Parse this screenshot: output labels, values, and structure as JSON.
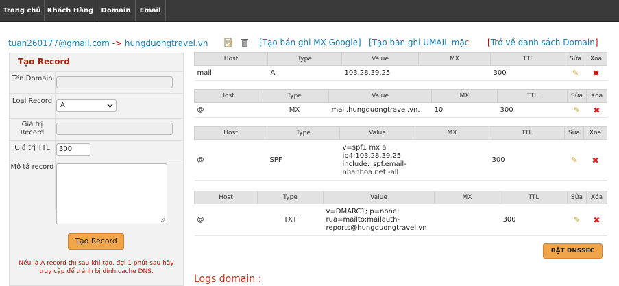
{
  "nav": [
    "Trang chủ",
    "Khách Hàng",
    "Domain",
    "Email"
  ],
  "header": {
    "email": "tuan260177@gmail.com",
    "arrow": "->",
    "domain": "hungduongtravel.vn",
    "link_mx": "[Tạo bản ghi MX Google]",
    "link_umail": "[Tạo bản ghi UMAIL mặc",
    "link_back_open": "[",
    "link_back_text": "Trở về danh sách Domain",
    "link_back_close": "]"
  },
  "form": {
    "title": "Tạo Record",
    "host_label": "Tên Domain",
    "type_label": "Loại Record",
    "type_value": "A",
    "value_label": "Giá trị Record",
    "ttl_label": "Giá trị TTL",
    "ttl_value": "300",
    "desc_label": "Mô tả record",
    "submit": "Tạo Record",
    "note": "Nếu là A record thì sau khi tạo, đợi 1 phút sau hãy truy cập để tránh bị dính cache DNS."
  },
  "columns": [
    "Host",
    "Type",
    "Value",
    "MX",
    "TTL",
    "Sửa",
    "Xóa"
  ],
  "records": [
    {
      "host": "mail",
      "type": "A",
      "value": "103.28.39.25",
      "mx": "",
      "ttl": "300"
    },
    {
      "host": "@",
      "type": "MX",
      "value": "mail.hungduongtravel.vn.",
      "mx": "10",
      "ttl": "300"
    },
    {
      "host": "@",
      "type": "SPF",
      "value": "v=spf1 mx a ip4:103.28.39.25 include:_spf.email-nhanhoa.net -all",
      "mx": "",
      "ttl": "300"
    },
    {
      "host": "@",
      "type": "TXT",
      "value": "v=DMARC1; p=none; rua=mailto:mailauth-reports@hungduongtravel.vn",
      "mx": "",
      "ttl": "300"
    }
  ],
  "dnssec_button": "BẬT DNSSEC",
  "logs_title": "Logs domain :",
  "icons": {
    "edit": "pencil-icon",
    "delete": "x-icon",
    "doc": "edit-doc-icon",
    "trash": "trash-icon"
  }
}
